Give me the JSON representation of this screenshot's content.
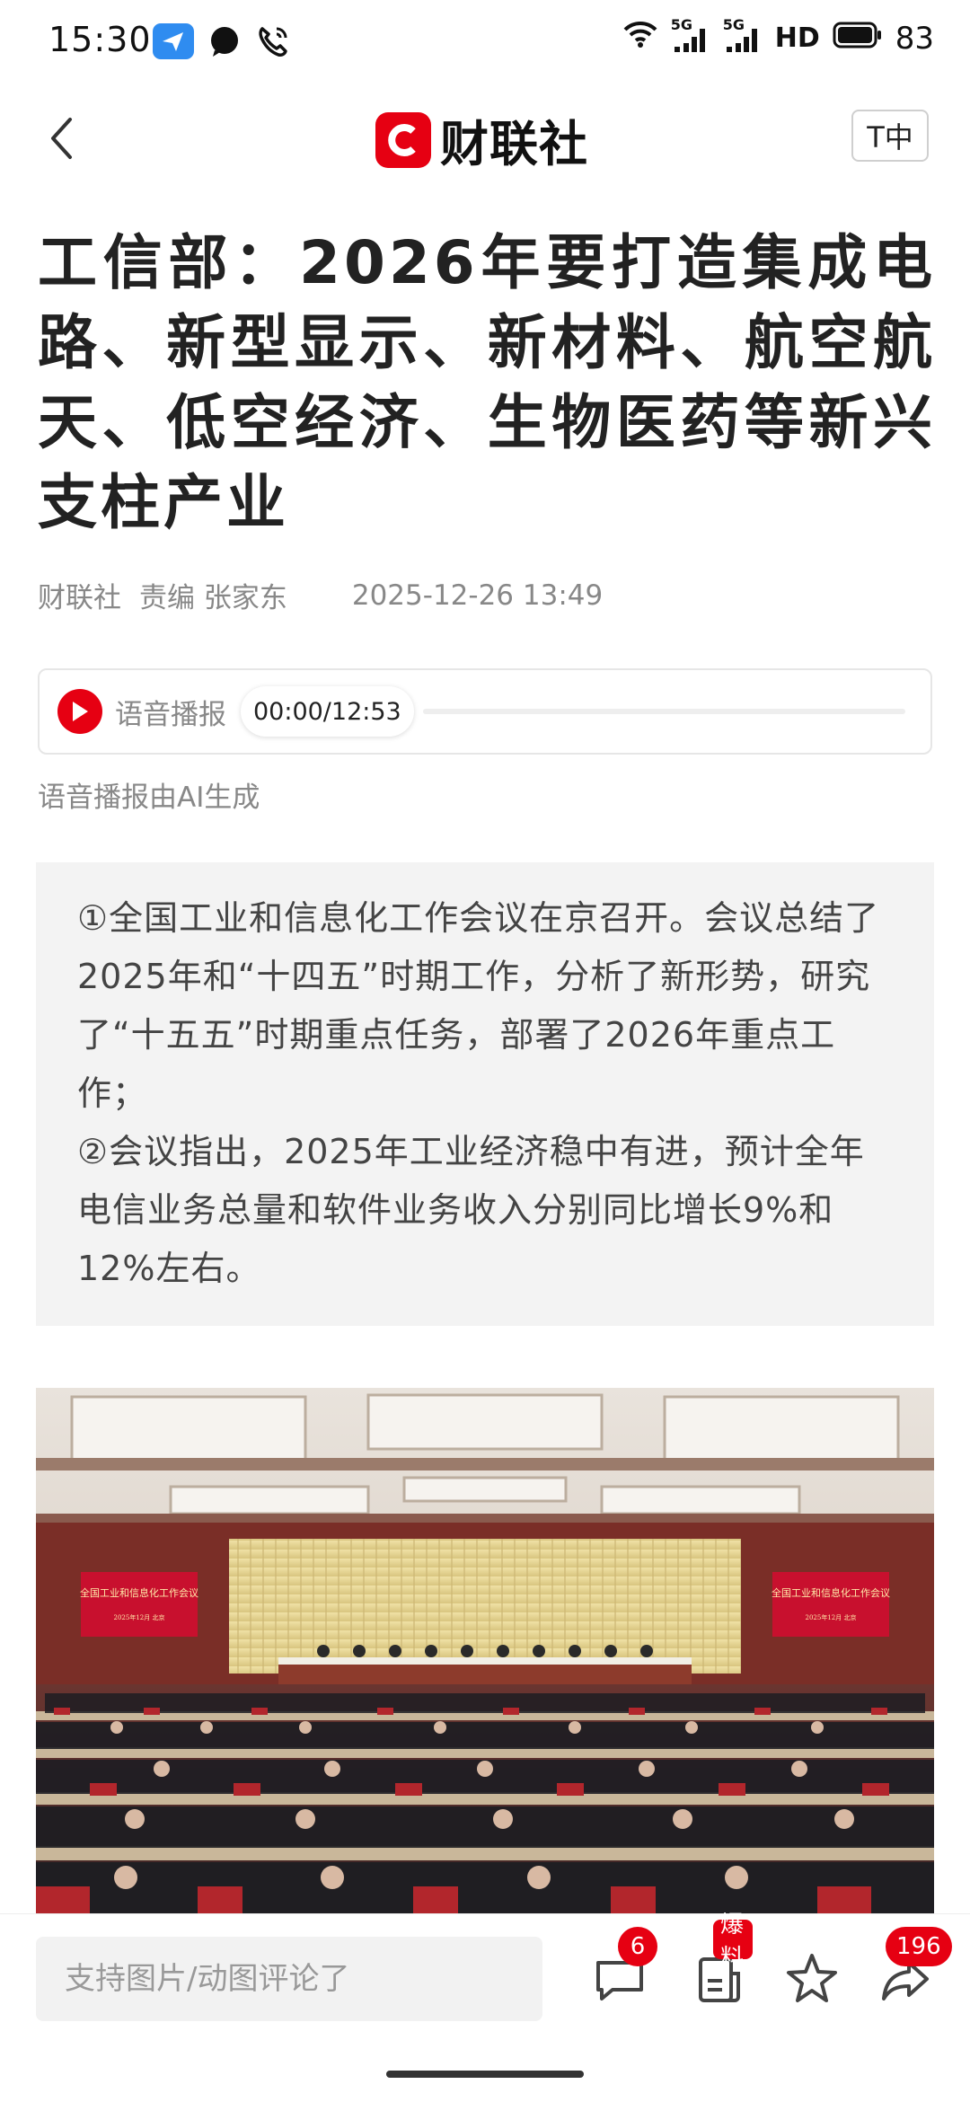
{
  "status_bar": {
    "time": "15:30",
    "network_1": "5G",
    "network_2": "5G",
    "hd_label": "HD",
    "battery": "83"
  },
  "header": {
    "brand": "财联社",
    "font_size_label": "T中"
  },
  "article": {
    "title": "工信部：2026年要打造集成电路、新型显示、新材料、航空航天、低空经济、生物医药等新兴支柱产业",
    "source": "财联社",
    "editor": "责编 张家东",
    "datetime": "2025-12-26 13:49"
  },
  "audio": {
    "label": "语音播报",
    "time": "00:00/12:53",
    "progress": 0,
    "note": "语音播报由AI生成"
  },
  "summary": {
    "point_1": "①全国工业和信息化工作会议在京召开。会议总结了2025年和“十四五”时期工作，分析了新形势，研究了“十五五”时期重点任务，部署了2026年重点工作；",
    "point_2": "②会议指出，2025年工业经济稳中有进，预计全年电信业务总量和软件业务收入分别同比增长9%和12%左右。"
  },
  "photo": {
    "banner_text": "全国工业和信息化工作会议",
    "banner_sub": "2025年12月 北京"
  },
  "bottom_bar": {
    "comment_placeholder": "支持图片/动图评论了",
    "comment_count": "6",
    "report_badge": "爆料",
    "share_count": "196"
  },
  "colors": {
    "brand_red": "#e60012",
    "summary_bg": "#f3f3f3",
    "meta_gray": "#888888"
  },
  "icons": [
    "back-arrow-icon",
    "send-icon",
    "message-icon",
    "phone-icon",
    "wifi-icon",
    "signal-icon",
    "battery-icon",
    "play-icon",
    "comment-icon",
    "report-icon",
    "star-icon",
    "share-icon"
  ]
}
